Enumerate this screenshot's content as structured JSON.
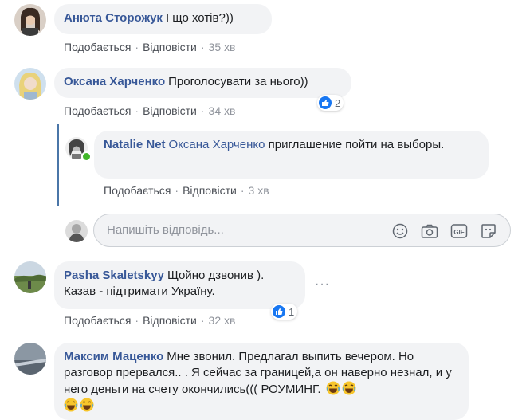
{
  "comments": [
    {
      "author": "Анюта Сторожук",
      "text": "І що хотів?))",
      "like": "Подобається",
      "reply": "Відповісти",
      "time": "35 хв"
    },
    {
      "author": "Оксана Харченко",
      "text": "Проголосувати за нього))",
      "like": "Подобається",
      "reply": "Відповісти",
      "time": "34 хв",
      "reactions": "2"
    },
    {
      "author": "Natalie Net",
      "mention": "Оксана Харченко",
      "text": "приглашение пойти на выборы.",
      "like": "Подобається",
      "reply": "Відповісти",
      "time": "3 хв"
    },
    {
      "author": "Pasha Skaletskyy",
      "text": "Щойно дзвонив ). Казав - підтримати Україну.",
      "like": "Подобається",
      "reply": "Відповісти",
      "time": "32 хв",
      "reactions": "1"
    },
    {
      "author": "Максим Маценко",
      "text": "Мне звонил. Предлагал выпить вечером. Но разговор прервался.. . Я сейчас за границей,а он наверно незнал, и у него деньги на счету окончились((( РОУМИНГ."
    }
  ],
  "reply_box": {
    "placeholder": "Напишіть відповідь...",
    "icons": [
      "emoji-icon",
      "camera-icon",
      "gif-icon",
      "sticker-icon"
    ]
  },
  "colors": {
    "link": "#385898",
    "bubble": "#f2f3f5",
    "like_blue": "#1877f2",
    "thread_line": "#4a76a8"
  }
}
